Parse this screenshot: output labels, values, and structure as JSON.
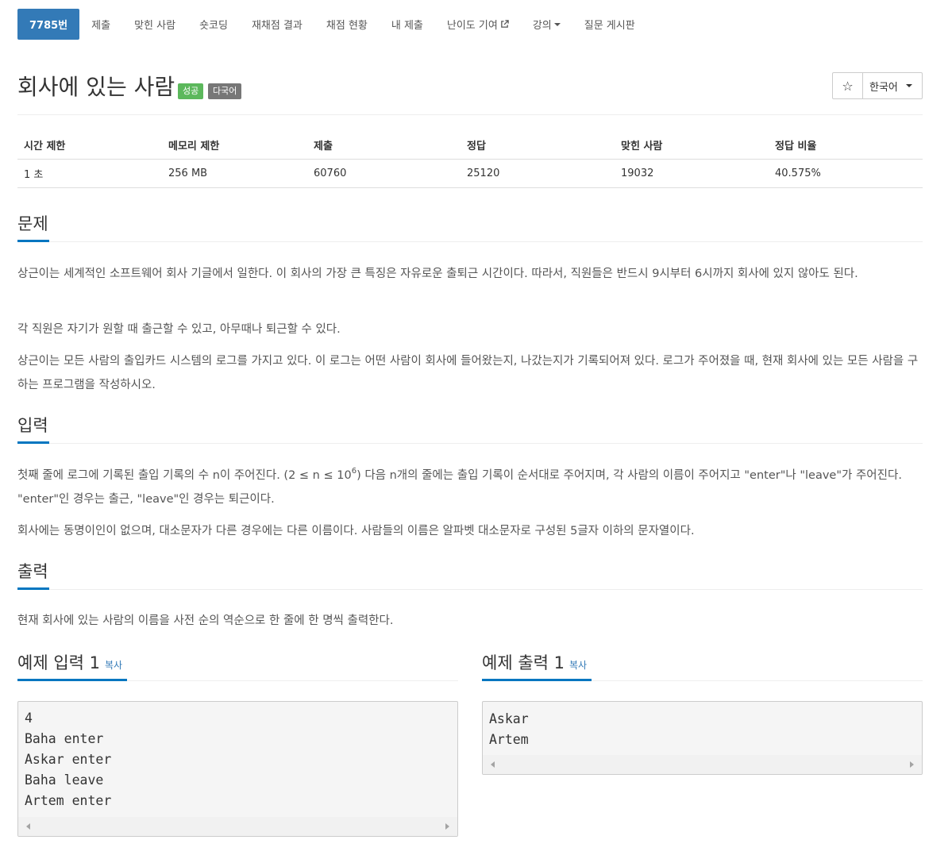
{
  "tabs": [
    {
      "label": "7785번",
      "active": true
    },
    {
      "label": "제출"
    },
    {
      "label": "맞힌 사람"
    },
    {
      "label": "숏코딩"
    },
    {
      "label": "재채점 결과"
    },
    {
      "label": "채점 현황"
    },
    {
      "label": "내 제출"
    },
    {
      "label": "난이도 기여"
    },
    {
      "label": "강의"
    },
    {
      "label": "질문 게시판"
    }
  ],
  "problem": {
    "title": "회사에 있는 사람",
    "badge_success": "성공",
    "badge_lang": "다국어",
    "star": "☆",
    "language": "한국어"
  },
  "stats": {
    "headers": [
      "시간 제한",
      "메모리 제한",
      "제출",
      "정답",
      "맞힌 사람",
      "정답 비율"
    ],
    "values": [
      "1 초",
      "256 MB",
      "60760",
      "25120",
      "19032",
      "40.575%"
    ]
  },
  "sections": {
    "problem_title": "문제",
    "problem_p1": "상근이는 세계적인 소프트웨어 회사 기글에서 일한다. 이 회사의 가장 큰 특징은 자유로운 출퇴근 시간이다. 따라서, 직원들은 반드시 9시부터 6시까지 회사에 있지 않아도 된다.",
    "problem_p2": "각 직원은 자기가 원할 때 출근할 수 있고, 아무때나 퇴근할 수 있다.",
    "problem_p3": "상근이는 모든 사람의 출입카드 시스템의 로그를 가지고 있다. 이 로그는 어떤 사람이 회사에 들어왔는지, 나갔는지가 기록되어져 있다. 로그가 주어졌을 때, 현재 회사에 있는 모든 사람을 구하는 프로그램을 작성하시오.",
    "input_title": "입력",
    "input_p1_a": "첫째 줄에 로그에 기록된 출입 기록의 수 n이 주어진다. (2 ≤ n ≤ 10",
    "input_p1_sup": "6",
    "input_p1_b": ") 다음 n개의 줄에는 출입 기록이 순서대로 주어지며, 각 사람의 이름이 주어지고 \"enter\"나 \"leave\"가 주어진다. \"enter\"인 경우는 출근, \"leave\"인 경우는 퇴근이다.",
    "input_p2": "회사에는 동명이인이 없으며, 대소문자가 다른 경우에는 다른 이름이다. 사람들의 이름은 알파벳 대소문자로 구성된 5글자 이하의 문자열이다.",
    "output_title": "출력",
    "output_p1": "현재 회사에 있는 사람의 이름을 사전 순의 역순으로 한 줄에 한 명씩 출력한다."
  },
  "samples": {
    "input_title": "예제 입력 1",
    "output_title": "예제 출력 1",
    "copy_label": "복사",
    "input_text": "4\nBaha enter\nAskar enter\nBaha leave\nArtem enter",
    "output_text": "Askar\nArtem"
  }
}
